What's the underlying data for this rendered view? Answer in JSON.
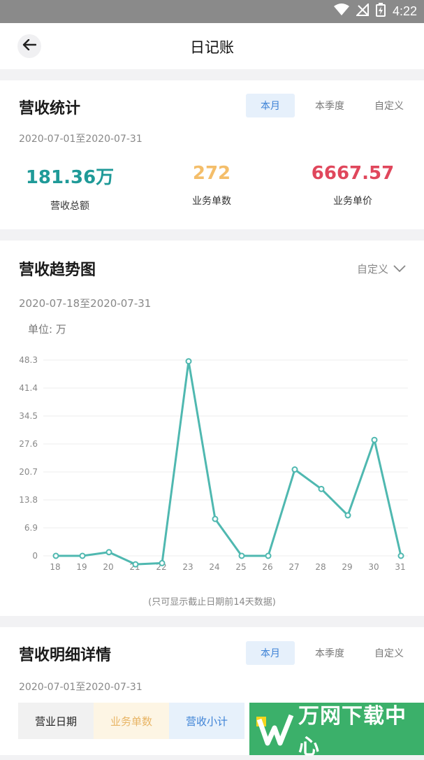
{
  "status": {
    "time": "4:22"
  },
  "header": {
    "title": "日记账"
  },
  "summary": {
    "title": "营收统计",
    "tabs": [
      "本月",
      "本季度",
      "自定义"
    ],
    "active_tab": 0,
    "date_range": "2020-07-01至2020-07-31",
    "stats": [
      {
        "value": "181.36万",
        "label": "营收总额",
        "color": "#1f9a98"
      },
      {
        "value": "272",
        "label": "业务单数",
        "color": "#f4be6a"
      },
      {
        "value": "6667.57",
        "label": "业务单价",
        "color": "#e0475c"
      }
    ]
  },
  "trend": {
    "title": "营收趋势图",
    "filter_label": "自定义",
    "date_range": "2020-07-18至2020-07-31",
    "unit_label": "单位: 万",
    "footnote": "(只可显示截止日期前14天数据)"
  },
  "chart_data": {
    "type": "line",
    "x": [
      "18",
      "19",
      "20",
      "21",
      "22",
      "23",
      "24",
      "25",
      "26",
      "27",
      "28",
      "29",
      "30",
      "31"
    ],
    "series": [
      {
        "values": [
          0,
          0,
          0.9,
          -2.1,
          -1.8,
          48.0,
          9.1,
          0,
          0,
          21.3,
          16.5,
          10.0,
          28.6,
          0
        ]
      }
    ],
    "yticks": [
      "0",
      "6.9",
      "13.8",
      "20.7",
      "27.6",
      "34.5",
      "41.4",
      "48.3"
    ],
    "ylim": [
      0,
      48.3
    ],
    "line_color": "#4fb8b0",
    "grid": true
  },
  "detail": {
    "title": "营收明细详情",
    "tabs": [
      "本月",
      "本季度",
      "自定义"
    ],
    "active_tab": 0,
    "date_range": "2020-07-01至2020-07-31",
    "columns": [
      {
        "label": "营业日期",
        "bg": "#f1f1f1",
        "color": "#222"
      },
      {
        "label": "业务单数",
        "bg": "#fdf5e4",
        "color": "#e8b566"
      },
      {
        "label": "营收小计",
        "bg": "#e7f1fb",
        "color": "#3d82d6"
      }
    ]
  },
  "watermark": {
    "text": "万网下载中心"
  }
}
